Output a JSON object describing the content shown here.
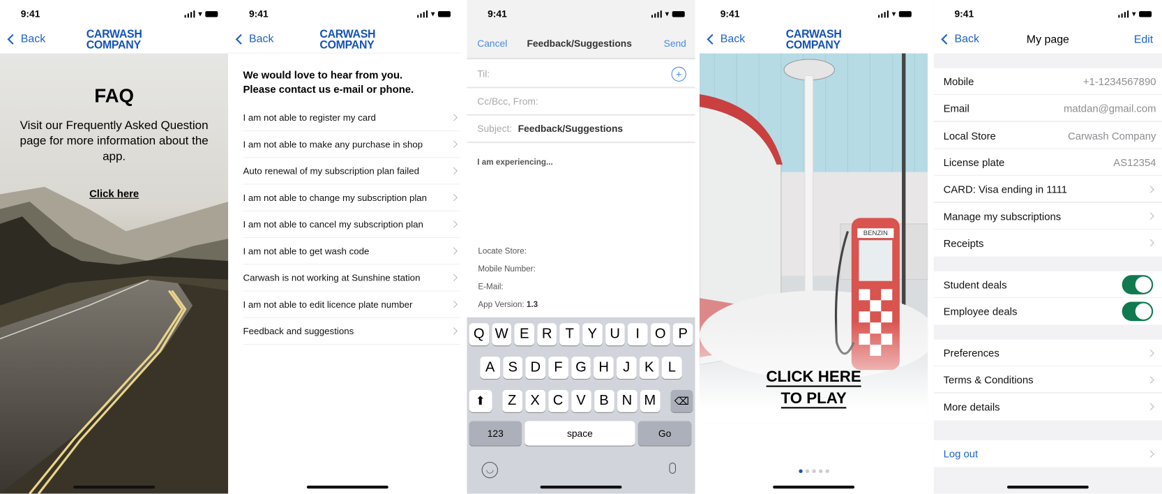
{
  "status_time": "9:41",
  "brand": {
    "line1": "CARWASH",
    "line2": "COMPANY",
    "color": "#1553b8"
  },
  "accent": "#1e62c8",
  "faq": {
    "back": "Back",
    "title": "FAQ",
    "text": "Visit our Frequently Asked Question page for more information about the app.",
    "link": "Click here"
  },
  "contact": {
    "back": "Back",
    "intro_line1": "We would love to hear from you.",
    "intro_line2": "Please contact us e-mail or phone.",
    "items": [
      "I am not able to register my card",
      "I am not able to make any purchase in shop",
      "Auto renewal of my subscription plan failed",
      "I am not able to change my subscription plan",
      "I am not able to cancel my subscription plan",
      "I am not able to get wash code",
      "Carwash is not working at Sunshine station",
      "I am not able to edit licence plate number",
      "Feedback and suggestions"
    ]
  },
  "mail": {
    "cancel": "Cancel",
    "title": "Feedback/Suggestions",
    "send": "Send",
    "to_label": "Til:",
    "cc_label": "Cc/Bcc, From:",
    "subject_label": "Subject:",
    "subject_value": "Feedback/Suggestions",
    "body": "I am experiencing...",
    "locate_store": "Locate Store:",
    "mobile_number": "Mobile Number:",
    "email": "E-Mail:",
    "app_version_label": "App Version:",
    "app_version": "1.3"
  },
  "keyboard": {
    "row1": [
      "Q",
      "W",
      "E",
      "R",
      "T",
      "Y",
      "U",
      "I",
      "O",
      "P"
    ],
    "row2": [
      "A",
      "S",
      "D",
      "F",
      "G",
      "H",
      "J",
      "K",
      "L"
    ],
    "row3": [
      "Z",
      "X",
      "C",
      "V",
      "B",
      "N",
      "M"
    ],
    "numbers": "123",
    "space": "space",
    "go": "Go"
  },
  "play": {
    "back": "Back",
    "cta_line1": "CLICK HERE",
    "cta_line2": "TO PLAY",
    "pump_label": "BENZIN",
    "page_count": 5,
    "current_page": 1
  },
  "mypage": {
    "back": "Back",
    "title": "My page",
    "edit": "Edit",
    "info": [
      {
        "label": "Mobile",
        "value": "+1-1234567890"
      },
      {
        "label": "Email",
        "value": "matdan@gmail.com"
      },
      {
        "label": "Local Store",
        "value": "Carwash Company"
      },
      {
        "label": "License plate",
        "value": "AS12354"
      }
    ],
    "links": [
      "CARD: Visa ending in 1111",
      "Manage my subscriptions",
      "Receipts"
    ],
    "toggles": [
      {
        "label": "Student deals",
        "on": true
      },
      {
        "label": "Employee deals",
        "on": true
      }
    ],
    "more": [
      "Preferences",
      "Terms & Conditions",
      "More details"
    ],
    "logout": "Log out"
  }
}
